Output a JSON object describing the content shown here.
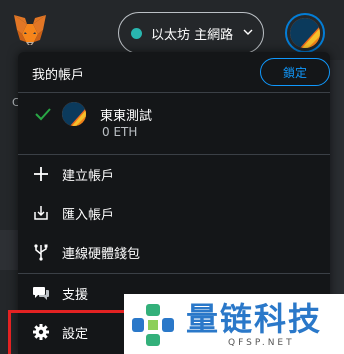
{
  "network": {
    "label": "以太坊 主網路",
    "dot_color": "#29b6af"
  },
  "menu": {
    "title": "我的帳戶",
    "lock_label": "鎖定",
    "account": {
      "name": "東東測試",
      "balance": "0 ETH"
    },
    "items": [
      {
        "label": "建立帳戶",
        "icon": "plus-icon"
      },
      {
        "label": "匯入帳戶",
        "icon": "import-icon"
      },
      {
        "label": "連線硬體錢包",
        "icon": "hardware-wallet-icon"
      },
      {
        "label": "支援",
        "icon": "support-chat-icon"
      },
      {
        "label": "設定",
        "icon": "gear-icon"
      }
    ]
  },
  "background": {
    "letter": "C"
  },
  "watermark": {
    "text": "量链科技",
    "sub": "QFSP.NET"
  },
  "colors": {
    "accent": "#1098fc",
    "check": "#28a745",
    "highlight": "#e32222",
    "background": "#24272a",
    "menu": "#141618"
  }
}
